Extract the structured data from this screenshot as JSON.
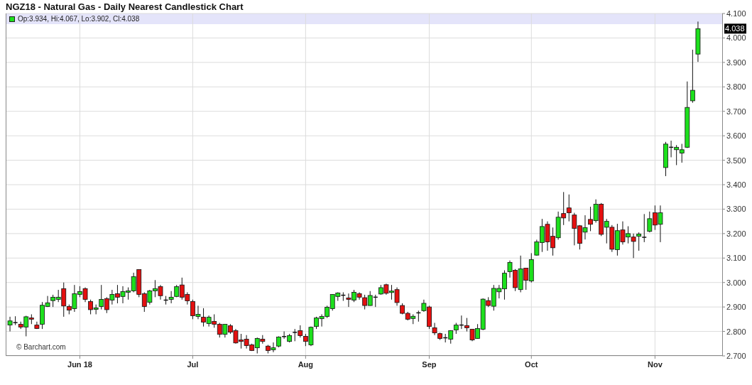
{
  "title": "NGZ18 - Natural Gas - Daily Nearest Candlestick Chart",
  "chart": {
    "legend": {
      "text": "Op:3.934, Hi:4.067, Lo:3.902, Cl:4.038"
    },
    "last_price": "4.038",
    "credit": "© Barchart.com",
    "chart_data": {
      "type": "candlestick",
      "ylim": [
        2.7,
        4.1
      ],
      "grid": true,
      "categories": [
        null,
        null,
        null,
        null,
        null,
        null,
        null,
        null,
        null,
        null,
        null,
        null,
        null,
        "Jun 18",
        null,
        null,
        null,
        null,
        null,
        null,
        null,
        null,
        null,
        null,
        null,
        null,
        null,
        null,
        null,
        null,
        null,
        null,
        null,
        null,
        "Jul",
        null,
        null,
        null,
        null,
        null,
        null,
        null,
        null,
        null,
        null,
        null,
        null,
        null,
        null,
        null,
        null,
        null,
        null,
        null,
        null,
        "Aug",
        null,
        null,
        null,
        null,
        null,
        null,
        null,
        null,
        null,
        null,
        null,
        null,
        null,
        null,
        null,
        null,
        null,
        null,
        null,
        null,
        null,
        null,
        "Sep",
        null,
        null,
        null,
        null,
        null,
        null,
        null,
        null,
        null,
        null,
        null,
        null,
        null,
        null,
        null,
        null,
        null,
        null,
        "Oct",
        null,
        null,
        null,
        null,
        null,
        null,
        null,
        null,
        null,
        null,
        null,
        null,
        null,
        null,
        null,
        null,
        null,
        null,
        null,
        null,
        null,
        null,
        "Nov",
        null,
        null,
        null,
        null,
        null,
        null,
        null,
        null
      ],
      "yticks": [
        {
          "value": 2.7,
          "label": "2.700"
        },
        {
          "value": 2.8,
          "label": "2.800"
        },
        {
          "value": 2.9,
          "label": "2.900"
        },
        {
          "value": 3.0,
          "label": "3.000"
        },
        {
          "value": 3.1,
          "label": "3.100"
        },
        {
          "value": 3.2,
          "label": "3.200"
        },
        {
          "value": 3.3,
          "label": "3.300"
        },
        {
          "value": 3.4,
          "label": "3.400"
        },
        {
          "value": 3.5,
          "label": "3.500"
        },
        {
          "value": 3.6,
          "label": "3.600"
        },
        {
          "value": 3.7,
          "label": "3.700"
        },
        {
          "value": 3.8,
          "label": "3.800"
        },
        {
          "value": 3.9,
          "label": "3.900"
        },
        {
          "value": 4.0,
          "label": "4.000"
        },
        {
          "value": 4.1,
          "label": "4.100"
        }
      ],
      "ohlc": [
        [
          2.826,
          2.86,
          2.8,
          2.843
        ],
        [
          2.836,
          2.862,
          2.826,
          2.836
        ],
        [
          2.829,
          2.84,
          2.81,
          2.818
        ],
        [
          2.818,
          2.864,
          2.78,
          2.86
        ],
        [
          2.855,
          2.87,
          2.83,
          2.85
        ],
        [
          2.826,
          2.84,
          2.81,
          2.812
        ],
        [
          2.829,
          2.92,
          2.81,
          2.907
        ],
        [
          2.902,
          2.945,
          2.9,
          2.917
        ],
        [
          2.926,
          2.95,
          2.9,
          2.94
        ],
        [
          2.931,
          2.97,
          2.92,
          2.94
        ],
        [
          2.975,
          3.0,
          2.86,
          2.904
        ],
        [
          2.902,
          2.91,
          2.87,
          2.887
        ],
        [
          2.893,
          2.99,
          2.88,
          2.954
        ],
        [
          2.951,
          2.985,
          2.94,
          2.963
        ],
        [
          2.975,
          2.98,
          2.92,
          2.931
        ],
        [
          2.922,
          2.93,
          2.87,
          2.889
        ],
        [
          2.89,
          2.91,
          2.87,
          2.896
        ],
        [
          2.902,
          2.99,
          2.89,
          2.931
        ],
        [
          2.934,
          2.94,
          2.875,
          2.889
        ],
        [
          2.928,
          2.97,
          2.91,
          2.951
        ],
        [
          2.954,
          2.99,
          2.915,
          2.94
        ],
        [
          2.943,
          2.985,
          2.915,
          2.963
        ],
        [
          2.96,
          2.98,
          2.93,
          2.966
        ],
        [
          2.966,
          3.04,
          2.96,
          3.024
        ],
        [
          3.053,
          3.053,
          2.94,
          2.951
        ],
        [
          2.954,
          2.96,
          2.88,
          2.902
        ],
        [
          2.919,
          2.97,
          2.91,
          2.966
        ],
        [
          2.966,
          3.01,
          2.94,
          2.975
        ],
        [
          2.983,
          2.99,
          2.93,
          2.946
        ],
        [
          2.928,
          2.945,
          2.91,
          2.928
        ],
        [
          2.931,
          2.965,
          2.915,
          2.94
        ],
        [
          2.943,
          2.99,
          2.94,
          2.983
        ],
        [
          2.99,
          3.02,
          2.93,
          2.94
        ],
        [
          2.951,
          2.96,
          2.91,
          2.925
        ],
        [
          2.922,
          2.93,
          2.85,
          2.864
        ],
        [
          2.861,
          2.905,
          2.85,
          2.87
        ],
        [
          2.858,
          2.895,
          2.82,
          2.838
        ],
        [
          2.832,
          2.865,
          2.82,
          2.858
        ],
        [
          2.841,
          2.87,
          2.815,
          2.829
        ],
        [
          2.829,
          2.835,
          2.775,
          2.788
        ],
        [
          2.788,
          2.83,
          2.775,
          2.829
        ],
        [
          2.823,
          2.83,
          2.79,
          2.797
        ],
        [
          2.803,
          2.81,
          2.75,
          2.753
        ],
        [
          2.765,
          2.79,
          2.73,
          2.759
        ],
        [
          2.768,
          2.785,
          2.73,
          2.742
        ],
        [
          2.745,
          2.75,
          2.72,
          2.722
        ],
        [
          2.733,
          2.775,
          2.71,
          2.771
        ],
        [
          2.768,
          2.785,
          2.75,
          2.759
        ],
        [
          2.74,
          2.745,
          2.71,
          2.722
        ],
        [
          2.725,
          2.755,
          2.715,
          2.733
        ],
        [
          2.74,
          2.78,
          2.735,
          2.777
        ],
        [
          2.779,
          2.8,
          2.77,
          2.779
        ],
        [
          2.759,
          2.79,
          2.755,
          2.783
        ],
        [
          2.796,
          2.81,
          2.76,
          2.796
        ],
        [
          2.803,
          2.825,
          2.775,
          2.783
        ],
        [
          2.78,
          2.79,
          2.74,
          2.759
        ],
        [
          2.745,
          2.82,
          2.74,
          2.817
        ],
        [
          2.82,
          2.86,
          2.81,
          2.855
        ],
        [
          2.852,
          2.87,
          2.82,
          2.861
        ],
        [
          2.861,
          2.905,
          2.855,
          2.899
        ],
        [
          2.893,
          2.952,
          2.885,
          2.951
        ],
        [
          2.943,
          2.96,
          2.925,
          2.957
        ],
        [
          2.948,
          2.96,
          2.925,
          2.948
        ],
        [
          2.937,
          2.955,
          2.9,
          2.931
        ],
        [
          2.928,
          2.97,
          2.92,
          2.96
        ],
        [
          2.954,
          2.96,
          2.93,
          2.94
        ],
        [
          2.938,
          2.95,
          2.89,
          2.906
        ],
        [
          2.906,
          2.965,
          2.905,
          2.947
        ],
        [
          2.94,
          2.95,
          2.9,
          2.94
        ],
        [
          2.953,
          2.99,
          2.95,
          2.979
        ],
        [
          2.991,
          2.995,
          2.95,
          2.956
        ],
        [
          2.959,
          2.99,
          2.93,
          2.965
        ],
        [
          2.971,
          2.98,
          2.905,
          2.918
        ],
        [
          2.906,
          2.915,
          2.87,
          2.874
        ],
        [
          2.874,
          2.88,
          2.845,
          2.85
        ],
        [
          2.853,
          2.87,
          2.83,
          2.862
        ],
        [
          2.876,
          2.885,
          2.84,
          2.876
        ],
        [
          2.885,
          2.93,
          2.88,
          2.915
        ],
        [
          2.9,
          2.905,
          2.81,
          2.82
        ],
        [
          2.815,
          2.835,
          2.785,
          2.794
        ],
        [
          2.791,
          2.795,
          2.765,
          2.771
        ],
        [
          2.774,
          2.79,
          2.755,
          2.774
        ],
        [
          2.768,
          2.805,
          2.75,
          2.803
        ],
        [
          2.806,
          2.835,
          2.79,
          2.826
        ],
        [
          2.826,
          2.865,
          2.81,
          2.826
        ],
        [
          2.824,
          2.855,
          2.8,
          2.815
        ],
        [
          2.809,
          2.81,
          2.76,
          2.765
        ],
        [
          2.771,
          2.83,
          2.77,
          2.812
        ],
        [
          2.809,
          2.935,
          2.805,
          2.932
        ],
        [
          2.926,
          2.94,
          2.9,
          2.906
        ],
        [
          2.903,
          2.99,
          2.885,
          2.976
        ],
        [
          2.962,
          2.99,
          2.935,
          2.976
        ],
        [
          2.974,
          3.05,
          2.93,
          3.038
        ],
        [
          3.044,
          3.09,
          3.02,
          3.082
        ],
        [
          3.05,
          3.055,
          2.965,
          2.979
        ],
        [
          2.971,
          3.11,
          2.96,
          3.056
        ],
        [
          3.059,
          3.06,
          2.97,
          3.009
        ],
        [
          3.006,
          3.12,
          3.0,
          3.094
        ],
        [
          3.112,
          3.175,
          3.11,
          3.166
        ],
        [
          3.163,
          3.26,
          3.125,
          3.229
        ],
        [
          3.238,
          3.25,
          3.13,
          3.166
        ],
        [
          3.189,
          3.225,
          3.11,
          3.142
        ],
        [
          3.183,
          3.29,
          3.175,
          3.267
        ],
        [
          3.282,
          3.37,
          3.235,
          3.264
        ],
        [
          3.305,
          3.36,
          3.25,
          3.285
        ],
        [
          3.276,
          3.285,
          3.152,
          3.221
        ],
        [
          3.232,
          3.235,
          3.135,
          3.16
        ],
        [
          3.206,
          3.275,
          3.176,
          3.224
        ],
        [
          3.258,
          3.31,
          3.21,
          3.238
        ],
        [
          3.253,
          3.34,
          3.245,
          3.32
        ],
        [
          3.32,
          3.325,
          3.19,
          3.197
        ],
        [
          3.226,
          3.26,
          3.16,
          3.25
        ],
        [
          3.226,
          3.235,
          3.125,
          3.136
        ],
        [
          3.134,
          3.24,
          3.11,
          3.212
        ],
        [
          3.215,
          3.25,
          3.155,
          3.166
        ],
        [
          3.186,
          3.23,
          3.16,
          3.2
        ],
        [
          3.186,
          3.2,
          3.1,
          3.168
        ],
        [
          3.189,
          3.205,
          3.13,
          3.198
        ],
        [
          3.185,
          3.28,
          3.165,
          3.185
        ],
        [
          3.209,
          3.29,
          3.205,
          3.261
        ],
        [
          3.285,
          3.315,
          3.215,
          3.235
        ],
        [
          3.238,
          3.315,
          3.165,
          3.285
        ],
        [
          3.47,
          3.575,
          3.435,
          3.566
        ],
        [
          3.549,
          3.58,
          3.512,
          3.553
        ],
        [
          3.543,
          3.562,
          3.48,
          3.553
        ],
        [
          3.529,
          3.567,
          3.49,
          3.543
        ],
        [
          3.553,
          3.822,
          3.55,
          3.716
        ],
        [
          3.743,
          3.952,
          3.735,
          3.786
        ],
        [
          3.934,
          4.067,
          3.902,
          4.038
        ]
      ]
    }
  }
}
